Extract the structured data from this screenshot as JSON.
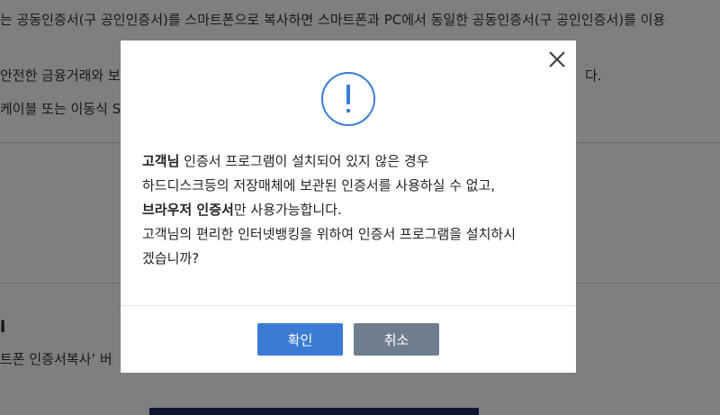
{
  "background": {
    "line1": "는 공동인증서(구 공인인증서)를 스마트폰으로 복사하면 스마트폰과 PC에서 동일한 공동인증서(구 공인인증서)를 이용",
    "line2": "안전한 금융거래와 보",
    "line2_tail": "다.",
    "line3": "케이블 또는 이동식 S",
    "heading": "l",
    "line4": "트폰 인증서복사’ 버"
  },
  "dialog": {
    "message": {
      "line1_bold": "고객님",
      "line1_rest": " 인증서 프로그램이 설치되어 있지 않은 경우",
      "line2": "하드디스크등의 저장매체에 보관된 인증서를 사용하실 수 없고,",
      "line3_bold": "브라우저 인증서",
      "line3_rest": "만 사용가능합니다.",
      "line4": "고객님의 편리한 인터넷뱅킹을 위하여 인증서 프로그램을 설치하시",
      "line5": "겠습니까?"
    },
    "confirm_label": "확인",
    "cancel_label": "취소"
  },
  "colors": {
    "accent": "#3a7bd5",
    "cancel": "#6f7e8e",
    "icon": "#3a7bd5",
    "overlay": "rgba(0,0,0,0.5)"
  },
  "icons": {
    "close": "close-icon",
    "alert": "exclamation-circle-icon"
  }
}
